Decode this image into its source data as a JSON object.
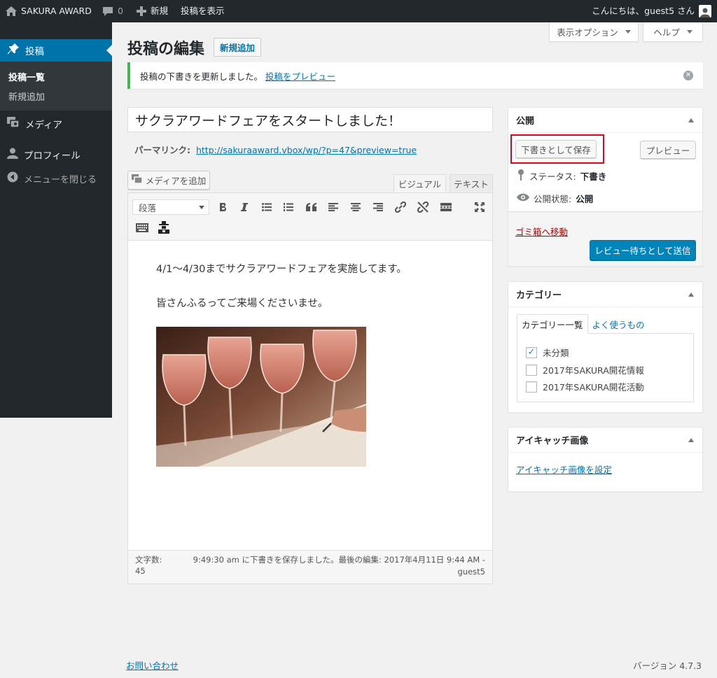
{
  "adminbar": {
    "site_name": "SAKURA AWARD",
    "comments_count": "0",
    "new_label": "新規",
    "view_post": "投稿を表示",
    "greeting": "こんにちは、guest5 さん"
  },
  "sidebar": {
    "posts_label": "投稿",
    "submenu": [
      "投稿一覧",
      "新規追加"
    ],
    "media_label": "メディア",
    "profile_label": "プロフィール",
    "collapse_label": "メニューを閉じる"
  },
  "screen_meta": {
    "options_label": "表示オプション",
    "help_label": "ヘルプ"
  },
  "page": {
    "title": "投稿の編集",
    "add_new": "新規追加"
  },
  "notice": {
    "text": "投稿の下書きを更新しました。",
    "link": "投稿をプレビュー"
  },
  "post": {
    "title": "サクラアワードフェアをスタートしました！",
    "permalink_label": "パーマリンク:",
    "permalink_url": "http://sakuraaward.vbox/wp/?p=47&preview=true"
  },
  "editor": {
    "add_media": "メディアを追加",
    "tab_visual": "ビジュアル",
    "tab_text": "テキスト",
    "format": "段落",
    "paragraphs": [
      "4/1～4/30までサクラアワードフェアを実施してます。",
      "皆さんふるってご来場くださいませ。"
    ],
    "word_count_label": "文字数:",
    "word_count": "45",
    "autosave_line1": "9:49:30 am に下書きを保存しました。最後の編集: 2017年4月11日 9:44 AM -",
    "autosave_line2": "guest5"
  },
  "publish": {
    "title": "公開",
    "save_draft": "下書きとして保存",
    "preview": "プレビュー",
    "status_label": "ステータス:",
    "status_value": "下書き",
    "visibility_label": "公開状態:",
    "visibility_value": "公開",
    "trash": "ゴミ箱へ移動",
    "submit": "レビュー待ちとして送信"
  },
  "categories": {
    "title": "カテゴリー",
    "tab_all": "カテゴリー一覧",
    "tab_popular": "よく使うもの",
    "items": [
      {
        "label": "未分類",
        "checked": true
      },
      {
        "label": "2017年SAKURA開花情報",
        "checked": false
      },
      {
        "label": "2017年SAKURA開花活動",
        "checked": false
      }
    ]
  },
  "thumbnail": {
    "title": "アイキャッチ画像",
    "set_link": "アイキャッチ画像を設定"
  },
  "footer": {
    "contact": "お問い合わせ",
    "version": "バージョン 4.7.3"
  },
  "colors": {
    "adminbar": "#23282d",
    "accent": "#0073aa",
    "primary_button": "#0085ba",
    "highlight": "#e60012"
  }
}
